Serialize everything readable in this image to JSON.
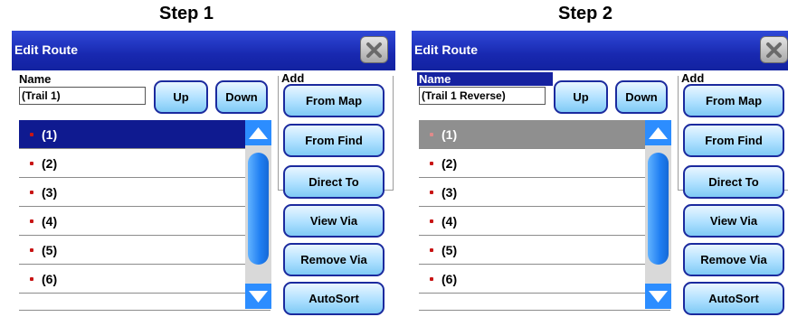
{
  "steps": [
    {
      "title": "Step 1",
      "window_title": "Edit Route",
      "name_label": "Name",
      "name_value": "(Trail 1)",
      "up_label": "Up",
      "down_label": "Down",
      "add_label": "Add",
      "buttons": [
        "From Map",
        "From Find",
        "Direct To",
        "View Via",
        "Remove Via",
        "AutoSort"
      ],
      "items": [
        "(1)",
        "(2)",
        "(3)",
        "(4)",
        "(5)",
        "(6)"
      ],
      "selected_item": "(1)"
    },
    {
      "title": "Step 2",
      "window_title": "Edit Route",
      "name_label": "Name",
      "name_value": "(Trail 1 Reverse)",
      "up_label": "Up",
      "down_label": "Down",
      "add_label": "Add",
      "buttons": [
        "From Map",
        "From Find",
        "Direct To",
        "View Via",
        "Remove Via",
        "AutoSort"
      ],
      "items": [
        "(1)",
        "(2)",
        "(3)",
        "(4)",
        "(5)",
        "(6)"
      ],
      "selected_item": "(1)"
    }
  ],
  "colors": {
    "titlebar": "#1828b0",
    "selected_row_step1": "#0f1a90",
    "selected_row_step2": "#8f8f8f",
    "button_fill": "#aee0ff",
    "scroll_accent": "#2c8dff",
    "route_point": "#c81515"
  },
  "icons": {
    "close": "close-x-icon",
    "scroll_up": "arrow-up-icon",
    "scroll_down": "arrow-down-icon",
    "route_point": "waypoint-dot-icon"
  }
}
